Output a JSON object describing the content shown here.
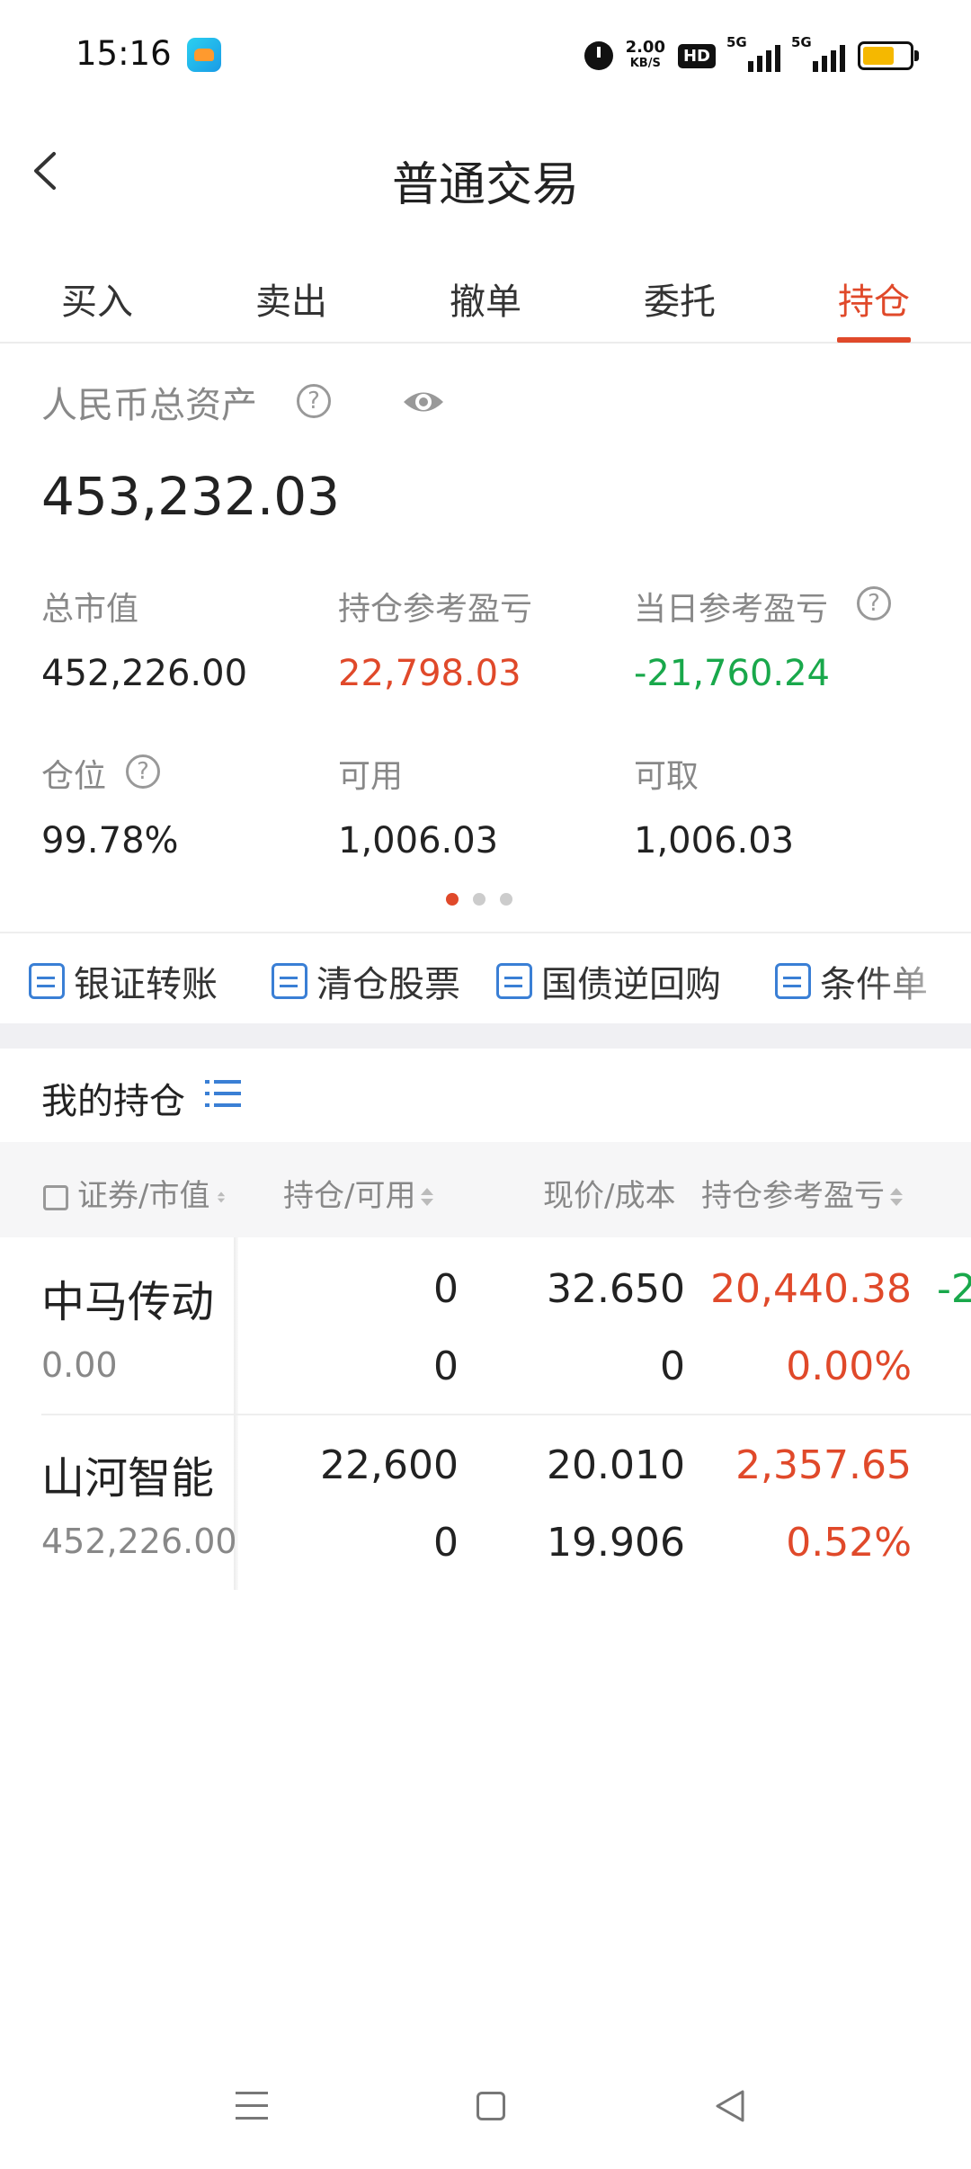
{
  "status_bar": {
    "time": "15:16",
    "speed_value": "2.00",
    "speed_unit": "KB/S",
    "hd_label": "HD",
    "sim1_label": "5G",
    "sim2_label": "5G"
  },
  "header": {
    "title": "普通交易"
  },
  "tabs": [
    {
      "label": "买入",
      "active": false
    },
    {
      "label": "卖出",
      "active": false
    },
    {
      "label": "撤单",
      "active": false
    },
    {
      "label": "委托",
      "active": false
    },
    {
      "label": "持仓",
      "active": true
    }
  ],
  "assets": {
    "label": "人民币总资产",
    "help_glyph": "?",
    "total": "453,232.03",
    "stats": [
      {
        "label": "总市值",
        "value": "452,226.00",
        "tone": "neutral"
      },
      {
        "label": "持仓参考盈亏",
        "value": "22,798.03",
        "tone": "up"
      },
      {
        "label": "当日参考盈亏",
        "value": "-21,760.24",
        "tone": "down",
        "help": true
      },
      {
        "label": "仓位",
        "value": "99.78%",
        "tone": "neutral",
        "help": true
      },
      {
        "label": "可用",
        "value": "1,006.03",
        "tone": "neutral"
      },
      {
        "label": "可取",
        "value": "1,006.03",
        "tone": "neutral"
      }
    ],
    "page_indicator": {
      "count": 3,
      "active": 0
    }
  },
  "quick_actions": [
    "银证转账",
    "清仓股票",
    "国债逆回购",
    "条件单"
  ],
  "holdings": {
    "title": "我的持仓",
    "columns": [
      "证券/市值",
      "持仓/可用",
      "现价/成本",
      "持仓参考盈亏"
    ],
    "rows": [
      {
        "name": "中马传动",
        "market_value": "0.00",
        "position": "0",
        "available": "0",
        "price": "32.650",
        "cost": "0",
        "pnl": "20,440.38",
        "pnl_pct": "0.00%",
        "overflow": "-2"
      },
      {
        "name": "山河智能",
        "market_value": "452,226.00",
        "position": "22,600",
        "available": "0",
        "price": "20.010",
        "cost": "19.906",
        "pnl": "2,357.65",
        "pnl_pct": "0.52%",
        "overflow": ""
      }
    ]
  },
  "colors": {
    "accent": "#e0492a",
    "down": "#19a84b",
    "link": "#3a7fd5"
  }
}
